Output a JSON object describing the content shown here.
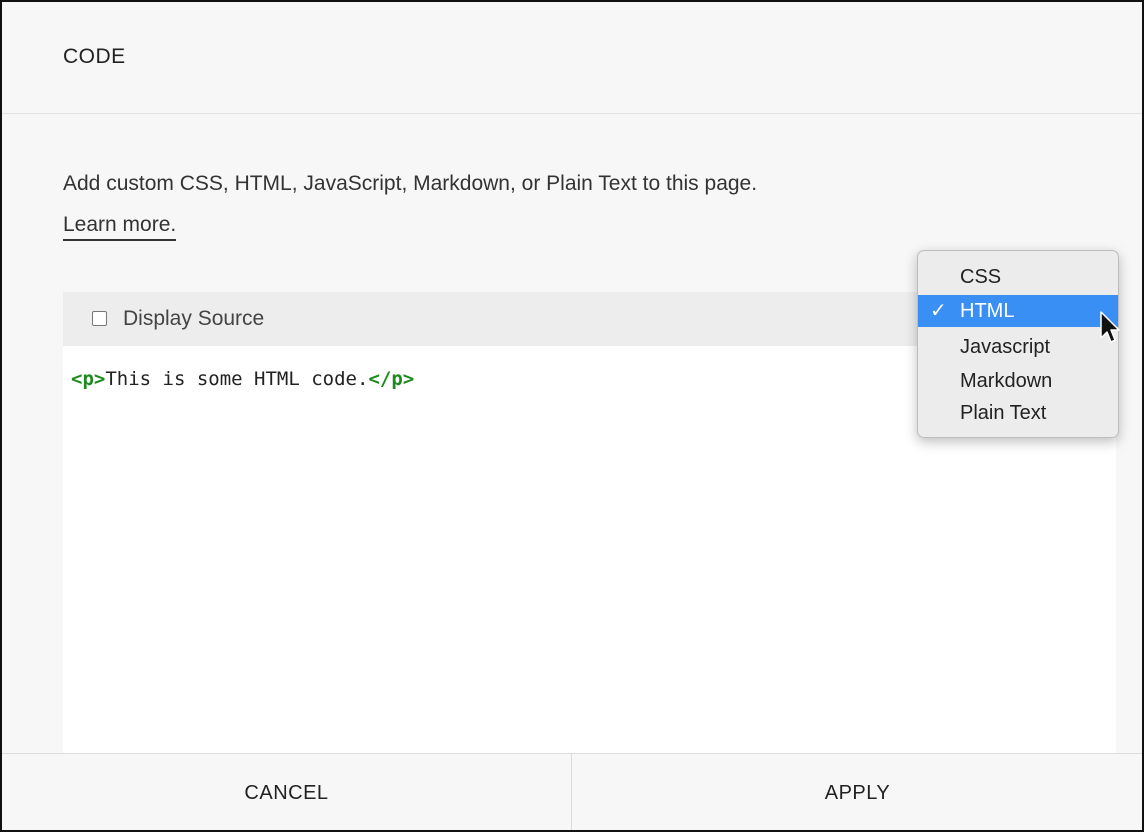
{
  "dialog": {
    "title": "CODE",
    "description": "Add custom CSS, HTML, JavaScript, Markdown, or Plain Text to this page.",
    "learn_more": "Learn more."
  },
  "editor": {
    "display_source_label": "Display Source",
    "display_source_checked": false,
    "code": {
      "open_tag": "<p>",
      "text": "This is some HTML code.",
      "close_tag": "</p>"
    }
  },
  "language_menu": {
    "options": [
      {
        "label": "CSS",
        "selected": false
      },
      {
        "label": "HTML",
        "selected": true
      },
      {
        "label": "Javascript",
        "selected": false
      },
      {
        "label": "Markdown",
        "selected": false
      },
      {
        "label": "Plain Text",
        "selected": false
      }
    ],
    "selected_color": "#3a8ff4"
  },
  "footer": {
    "cancel_label": "CANCEL",
    "apply_label": "APPLY"
  }
}
